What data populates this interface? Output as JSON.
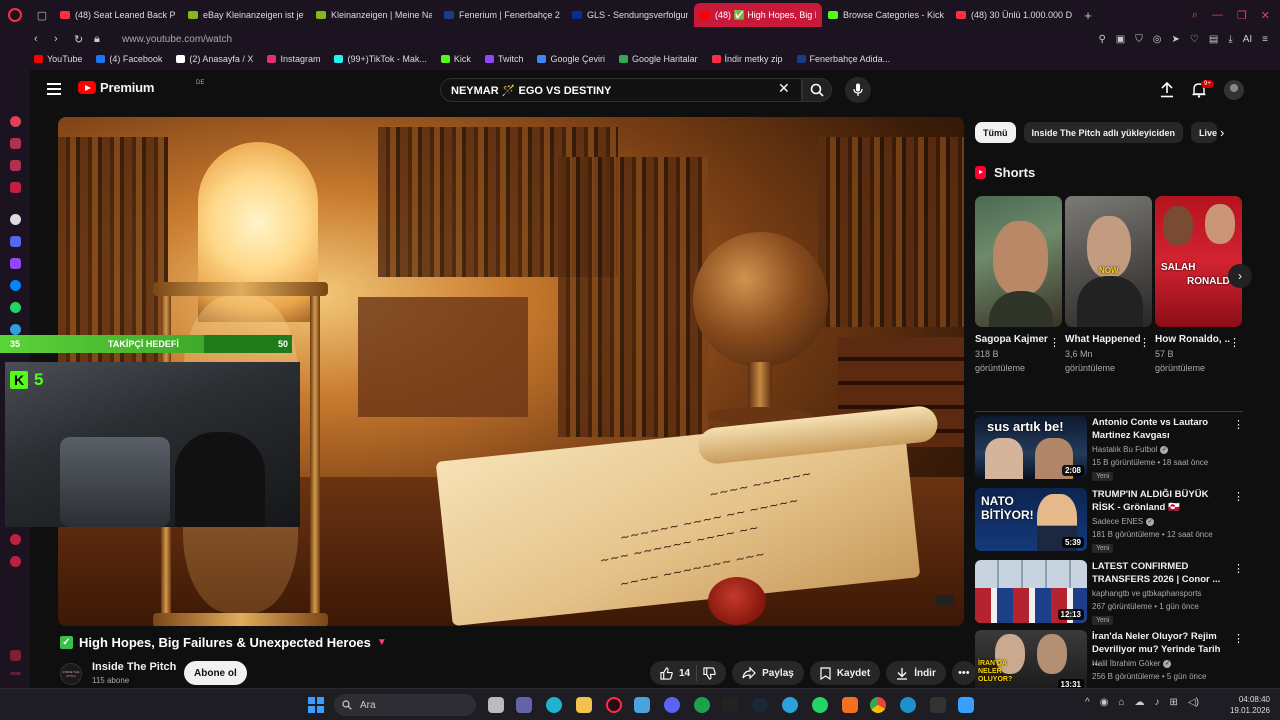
{
  "browser": {
    "tabs": [
      {
        "label": "(48) Seat Leaned Back Pi",
        "color": "#ff2e44"
      },
      {
        "label": "eBay Kleinanzeigen ist jetz",
        "color": "#86b817"
      },
      {
        "label": "Kleinanzeigen | Meine Nac",
        "color": "#86b817"
      },
      {
        "label": "Fenerium | Fenerbahçe 20",
        "color": "#1a3b8c"
      },
      {
        "label": "GLS - Sendungsverfolgun",
        "color": "#0b2a9c"
      },
      {
        "label": "(48) ✅ High Hopes, Big F",
        "color": "#ff0000"
      },
      {
        "label": "Browse Categories - Kick",
        "color": "#53fc18"
      },
      {
        "label": "(48) 30 Ünlü 1.000.000 De",
        "color": "#ff2e44"
      }
    ],
    "active_tab_index": 5,
    "url": "www.youtube.com/watch",
    "ai_label": "AI",
    "bookmarks": [
      {
        "label": "YouTube",
        "color": "#ff0000"
      },
      {
        "label": "(4) Facebook",
        "color": "#1877f2"
      },
      {
        "label": "(2) Anasayfa / X",
        "color": "#ffffff"
      },
      {
        "label": "Instagram",
        "color": "#e1306c"
      },
      {
        "label": "(99+)TikTok - Mak...",
        "color": "#25f4ee"
      },
      {
        "label": "Kick",
        "color": "#53fc18"
      },
      {
        "label": "Twitch",
        "color": "#9146ff"
      },
      {
        "label": "Google Çeviri",
        "color": "#4285f4"
      },
      {
        "label": "Google Haritalar",
        "color": "#34a853"
      },
      {
        "label": "İndir metky zip",
        "color": "#ff2e44"
      },
      {
        "label": "Fenerbahçe Adida...",
        "color": "#1a3b8c"
      }
    ]
  },
  "youtube": {
    "brand": "Premium",
    "region": "DE",
    "search_query": "NEYMAR 🪄 EGO VS DESTINY",
    "notification_count": "9+",
    "video": {
      "title": "High Hopes, Big Failures & Unexpected Heroes",
      "channel": "Inside The Pitch",
      "channel_logo_text": "INSIDE THE PITCH",
      "subscribers": "115 abone",
      "subscribe_label": "Abone ol",
      "likes": "14",
      "share_label": "Paylaş",
      "save_label": "Kaydet",
      "download_label": "İndir"
    },
    "chips": [
      "Tümü",
      "Inside The Pitch adlı yükleyiciden",
      "Live"
    ],
    "shorts_heading": "Shorts",
    "shorts": [
      {
        "title": "Sagopa Kajmer - ...",
        "views_line1": "318 B",
        "views_line2": "görüntüleme",
        "caption": ""
      },
      {
        "title": "What Happened t...",
        "views_line1": "3,6 Mn",
        "views_line2": "görüntüleme",
        "caption": "NOW"
      },
      {
        "title": "How Ronaldo, ...",
        "views_line1": "57 B",
        "views_line2": "görüntüleme",
        "caption_a": "SALAH",
        "caption_b": "RONALDO"
      }
    ],
    "recommendations": [
      {
        "title": "Antonio Conte vs Lautaro Martinez Kavgası",
        "channel": "Hastalık Bu Futbol",
        "verified": true,
        "meta": "15 B görüntüleme • 18 saat önce",
        "badge": "Yeni",
        "duration": "2:08",
        "thumb_text": "sus artık be!"
      },
      {
        "title": "TRUMP'IN ALDIĞI BÜYÜK RİSK - Grönland 🇬🇱",
        "channel": "Sadece ENES",
        "verified": true,
        "meta": "181 B görüntüleme • 12 saat önce",
        "badge": "Yeni",
        "duration": "5:39",
        "thumb_text": "NATO BİTİYOR!"
      },
      {
        "title": "LATEST CONFIRMED TRANSFERS  2026 | Conor ...",
        "channel": "kaphangtb ve gtbkaphansports",
        "verified": false,
        "meta": "267 görüntüleme • 1 gün önce",
        "badge": "Yeni",
        "duration": "12:13",
        "thumb_text": ""
      },
      {
        "title": "İran'da Neler Oluyor? Rejim Devriliyor mu? Yerinde Tarih ...",
        "channel": "Halil İbrahim Göker",
        "verified": true,
        "meta": "256 B görüntüleme • 5 gün önce",
        "badge": "",
        "duration": "13:31",
        "thumb_text": "İRAN'DA NELER OLUYOR?"
      }
    ]
  },
  "overlay": {
    "goal_current": "35",
    "goal_label": "TAKİPÇİ HEDEFİ",
    "goal_target": "50",
    "goal_progress": 0.7,
    "kick_logo": "K",
    "kick_count": "5"
  },
  "taskbar": {
    "search_placeholder": "Ara",
    "time": "04:08:40",
    "date": "19.01.2026"
  }
}
